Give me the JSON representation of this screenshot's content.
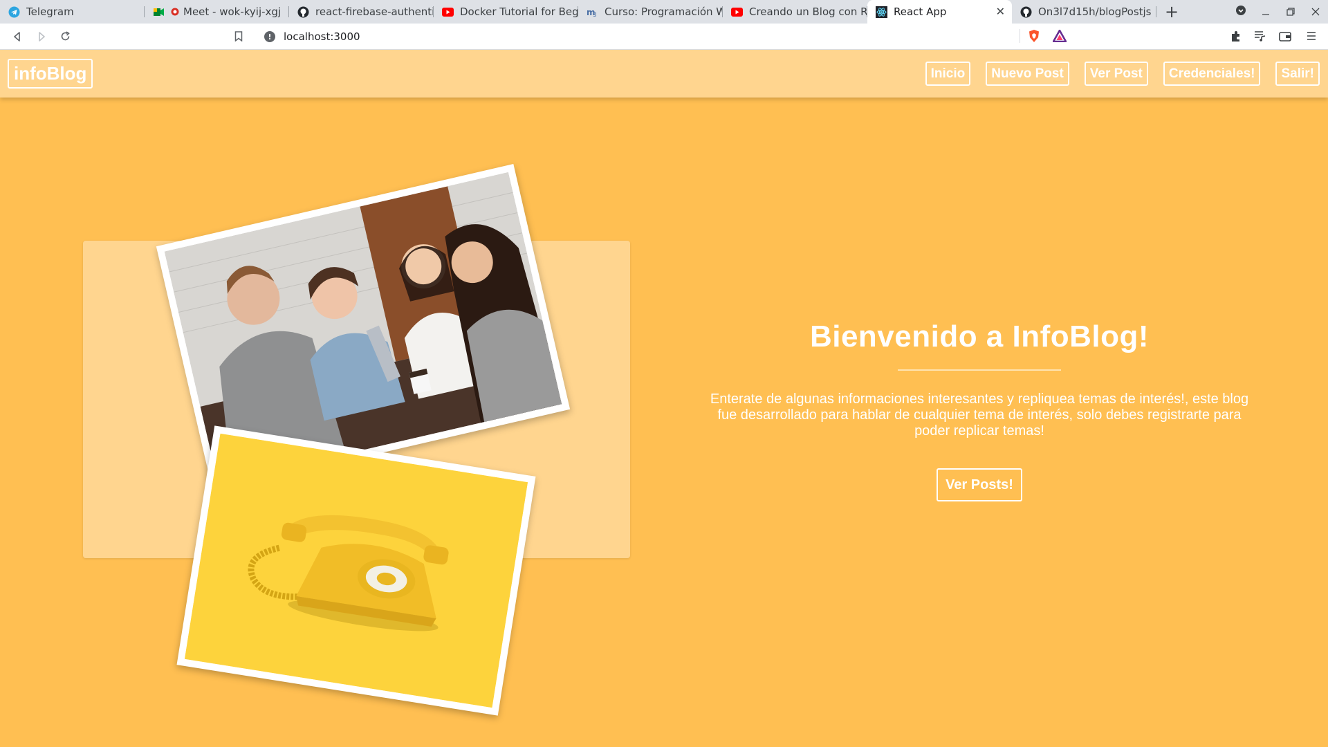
{
  "browser": {
    "tabs": [
      {
        "title": "Telegram",
        "icon": "telegram-icon",
        "active": false
      },
      {
        "title": "Meet - wok-kyij-xgj",
        "icon": "meet-icon",
        "active": false
      },
      {
        "title": "react-firebase-authentica",
        "icon": "github-icon",
        "active": false
      },
      {
        "title": "Docker Tutorial for Beginn",
        "icon": "youtube-icon",
        "active": false
      },
      {
        "title": "Curso: Programación Web",
        "icon": "course-icon",
        "active": false
      },
      {
        "title": "Creando un Blog con Reac",
        "icon": "youtube-icon",
        "active": false
      },
      {
        "title": "React App",
        "icon": "react-icon",
        "active": true
      },
      {
        "title": "On3l7d15h/blogPostjs",
        "icon": "github-icon",
        "active": false
      }
    ],
    "new_tab": "+",
    "close_tab": "✕",
    "url": "localhost:3000"
  },
  "site": {
    "brand": "infoBlog",
    "nav": [
      "Inicio",
      "Nuevo Post",
      "Ver Post",
      "Credenciales!",
      "Salir!"
    ]
  },
  "hero": {
    "title": "Bienvenido a InfoBlog!",
    "text": "Enterate de algunas informaciones interesantes y repliquea temas de interés!, este blog fue desarrollado para hablar de cualquier tema de interés, solo debes registrarte para poder replicar temas!",
    "button": "Ver Posts!"
  },
  "colors": {
    "page_bg": "#ffbf52",
    "navbar_bg": "#ffd58f",
    "accent": "#ffffff"
  }
}
